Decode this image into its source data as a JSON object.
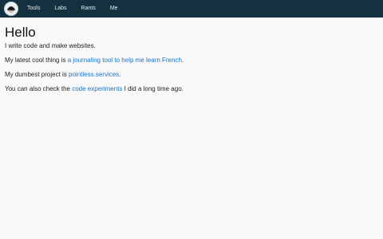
{
  "nav": {
    "items": [
      {
        "label": "Tools"
      },
      {
        "label": "Labs"
      },
      {
        "label": "Rants"
      },
      {
        "label": "Me"
      }
    ]
  },
  "main": {
    "title": "Hello",
    "intro": "I write code and make websites.",
    "p2": {
      "before": "My latest cool thing is ",
      "link": "a journaling tool to help me learn French",
      "after": "."
    },
    "p3": {
      "before": "My dumbest project is ",
      "link": "pointless.services",
      "after": "."
    },
    "p4": {
      "before": "You can also check the ",
      "link": "code experiments",
      "after": " I did a long time ago."
    }
  },
  "colors": {
    "nav_bg": "#13313f",
    "link": "#1a73c9",
    "page_bg": "#f9f9f9"
  }
}
